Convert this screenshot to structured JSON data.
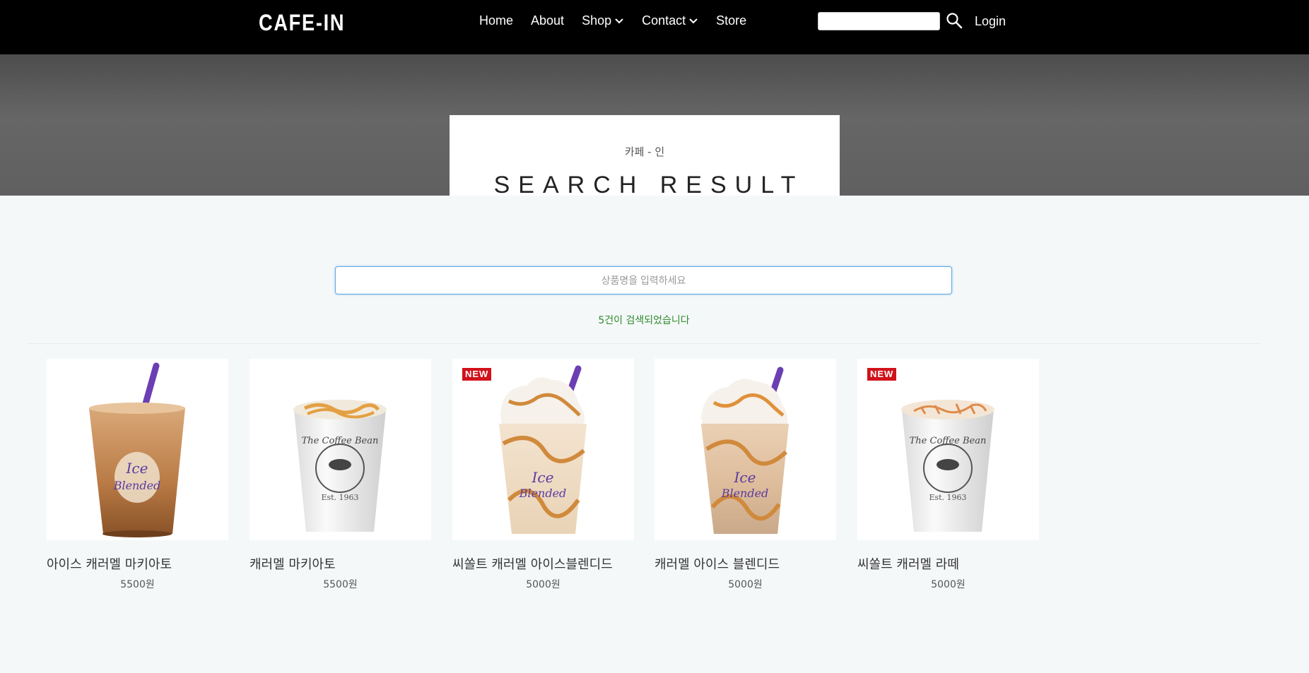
{
  "nav": {
    "logo": "CAFE-IN",
    "links": [
      "Home",
      "About",
      "Shop",
      "Contact",
      "Store"
    ],
    "login": "Login",
    "search_value": ""
  },
  "hero": {
    "subtitle": "카페 - 인",
    "title": "SEARCH RESULT"
  },
  "search": {
    "placeholder": "상품명을 입력하세요",
    "result_text": "5건이 검색되었습니다"
  },
  "products": [
    {
      "name": "아이스 캐러멜 마키아토",
      "price": "5500원",
      "badge": "",
      "image": "iced-caramel-macchiato-cup"
    },
    {
      "name": "캐러멜 마키아토",
      "price": "5500원",
      "badge": "",
      "image": "hot-caramel-macchiato-cup"
    },
    {
      "name": "씨쏠트 캐러멜 아이스블렌디드",
      "price": "5000원",
      "badge": "NEW",
      "image": "sea-salt-caramel-ice-blended-cup"
    },
    {
      "name": "캐러멜 아이스 블렌디드",
      "price": "5000원",
      "badge": "",
      "image": "caramel-ice-blended-cup"
    },
    {
      "name": "씨쏠트 캐러멜 라떼",
      "price": "5000원",
      "badge": "NEW",
      "image": "sea-salt-caramel-latte-cup"
    }
  ],
  "colors": {
    "navbar": "#000000",
    "badge": "#d0121b",
    "result_text": "#2e8b2e",
    "straw": "#6b3fb3"
  }
}
